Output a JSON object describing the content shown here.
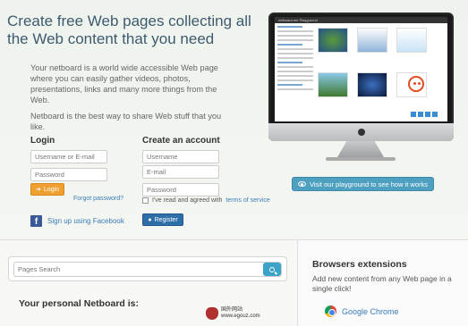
{
  "hero": {
    "title": "Create free Web pages collecting all the Web content that you need",
    "intro_1": "Your netboard is a world wide accessible Web page where you can easily gather videos, photos, presentations, links and many more things from the Web.",
    "intro_2": "Netboard is the best way to share Web stuff that you like."
  },
  "login": {
    "title": "Login",
    "username_placeholder": "Username or E-mail",
    "password_placeholder": "Password",
    "login_label": "Login",
    "forgot_label": "Forgot password?",
    "facebook_label": "Sign up using Facebook"
  },
  "create": {
    "title": "Create an account",
    "username_placeholder": "Username",
    "email_placeholder": "E-mail",
    "password_placeholder": "Password",
    "agree_prefix": "I've read and agreed with",
    "tos_label": "terms of service",
    "register_label": "Register"
  },
  "showcase": {
    "playground_label": "Visit our playground to see how it works",
    "screen_title": "netboard.me Playground"
  },
  "search": {
    "placeholder": "Pages Search"
  },
  "personal": {
    "title": "Your personal Netboard is:"
  },
  "extensions": {
    "title": "Browsers extensions",
    "description": "Add new content from any Web page in a single click!",
    "chrome_label": "Google Chrome"
  },
  "watermark": {
    "line1": "国外网站",
    "line2": "www.egouz.com"
  },
  "colors": {
    "accent_orange": "#f0a030",
    "accent_blue": "#2f6fa9",
    "link": "#3a7db8",
    "playground": "#4ea0c0"
  }
}
